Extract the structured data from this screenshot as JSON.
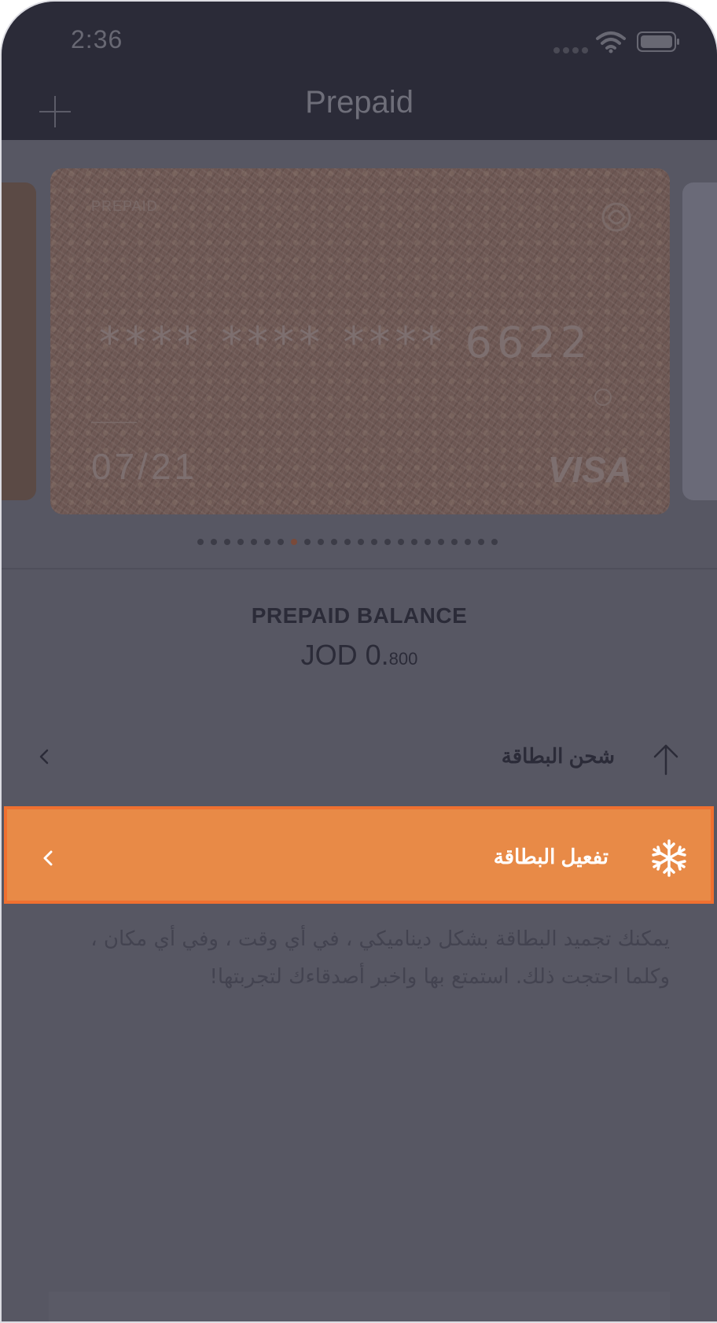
{
  "status": {
    "time": "2:36"
  },
  "nav": {
    "title": "Prepaid"
  },
  "card": {
    "kind": "PREPAID",
    "number": "**** **** **** 6622",
    "holder": "ـــــــــــ",
    "expiry": "07/21",
    "brand": "VISA"
  },
  "pager": {
    "count": 23,
    "active_index": 7
  },
  "balance": {
    "label": "PREPAID BALANCE",
    "currency": "JOD 0.",
    "decimals": "800"
  },
  "actions": {
    "charge_label": "شحن البطاقة",
    "activate_label": "تفعيل البطاقة"
  },
  "description": "يمكنك تجميد البطاقة بشكل ديناميكي ، في أي وقت ، وفي أي مكان ، وكلما احتجت ذلك. استمتع بها واخبر أصدقاءك لتجربتها!",
  "colors": {
    "accent": "#e88a47",
    "accent_border": "#f07030",
    "overlay": "#575763",
    "header": "#2b2b38"
  }
}
